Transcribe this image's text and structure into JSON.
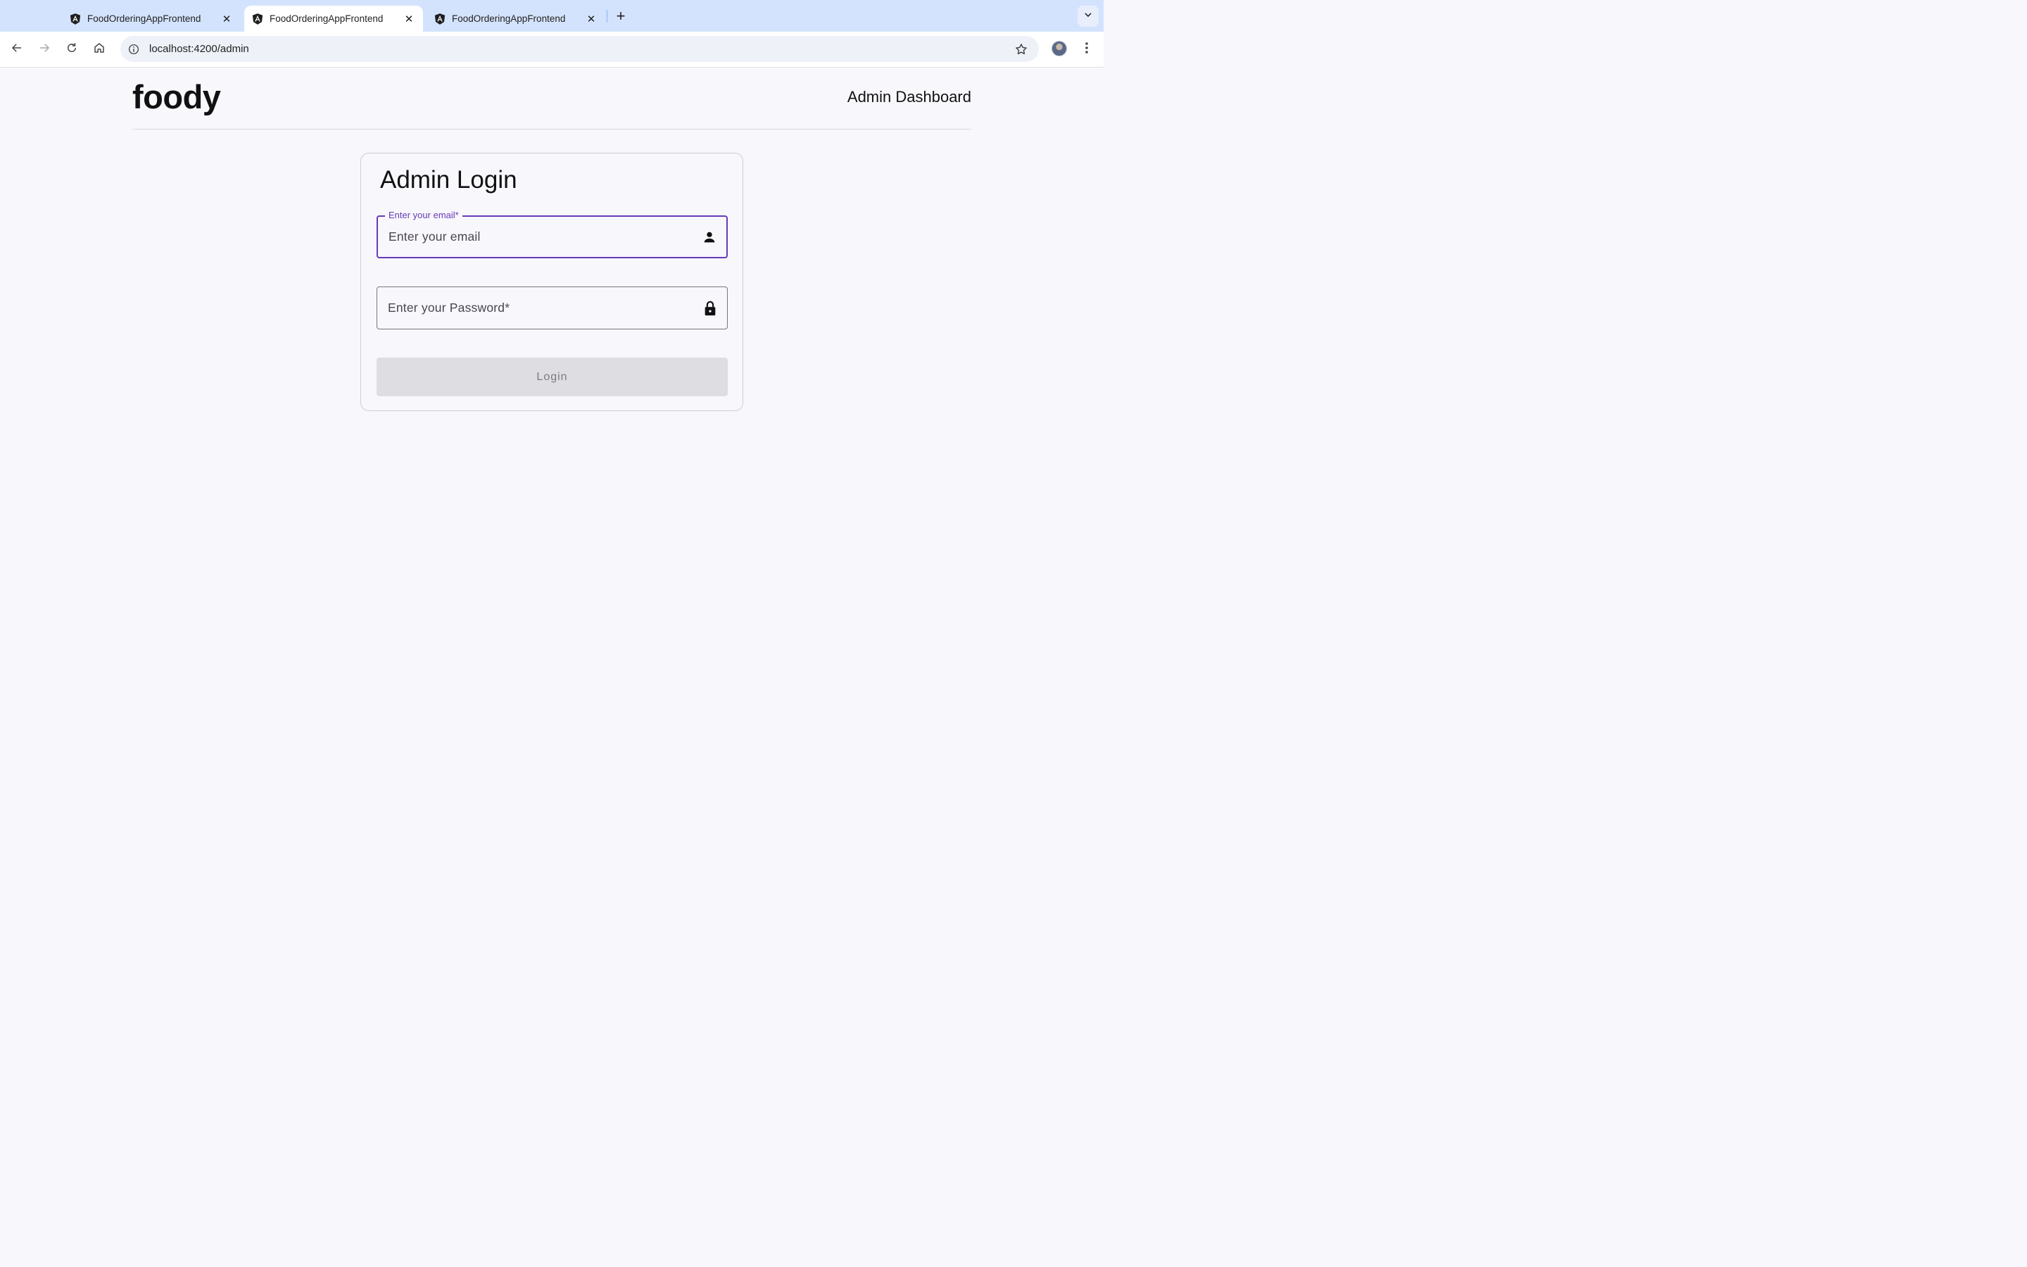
{
  "browser": {
    "tabs": [
      {
        "title": "FoodOrderingAppFrontend",
        "active": false
      },
      {
        "title": "FoodOrderingAppFrontend",
        "active": true
      },
      {
        "title": "FoodOrderingAppFrontend",
        "active": false
      }
    ],
    "new_tab_label": "+",
    "url": "localhost:4200/admin"
  },
  "header": {
    "logo": "foody",
    "nav_link": "Admin Dashboard"
  },
  "login_form": {
    "title": "Admin Login",
    "email": {
      "label": "Enter your email*",
      "placeholder": "Enter your email",
      "value": "",
      "icon": "person-icon"
    },
    "password": {
      "placeholder": "Enter your Password*",
      "value": "",
      "icon": "lock-icon"
    },
    "submit_label": "Login"
  },
  "colors": {
    "focus_accent": "#673ab7",
    "page_background": "#f8f7fc",
    "disabled_button": "#dedde2",
    "tab_strip": "#d3e3fd"
  }
}
